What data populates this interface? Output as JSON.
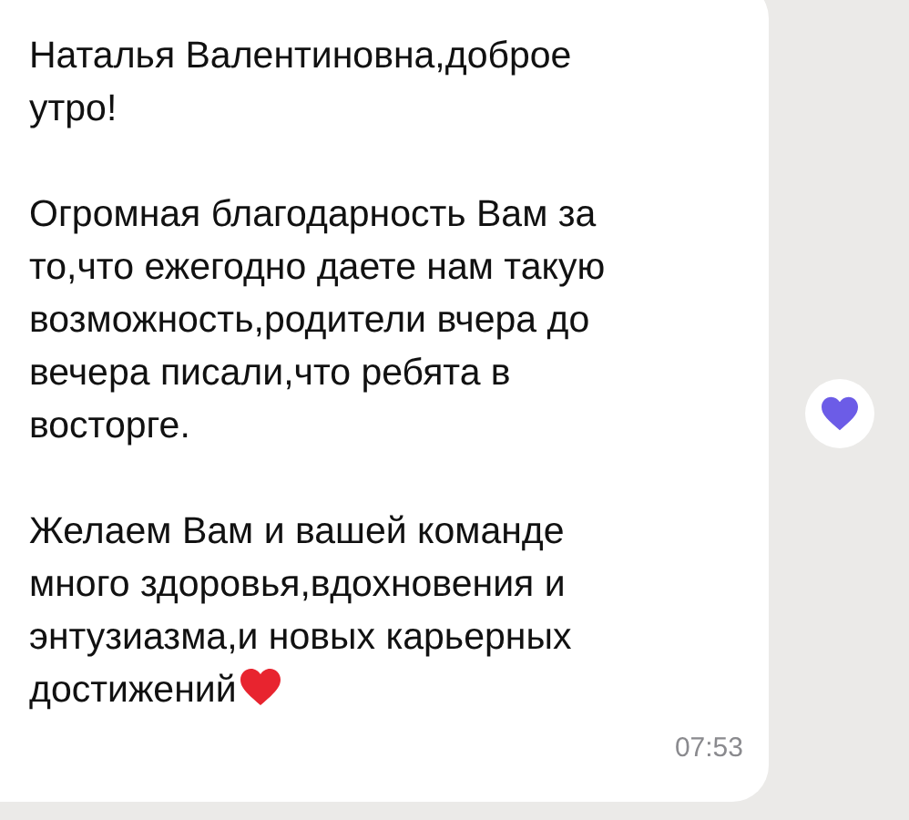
{
  "message": {
    "paragraphs": [
      {
        "lines": [
          "Наталья Валентиновна,доброе",
          "утро!"
        ],
        "heart": false
      },
      {
        "lines": [
          "Огромная благодарность Вам за",
          "то,что ежегодно даете нам такую",
          "возможность,родители вчера до",
          "вечера писали,что ребята в",
          "восторге."
        ],
        "heart": false
      },
      {
        "lines": [
          "Желаем Вам и вашей команде",
          "много здоровья,вдохновения и",
          "энтузиазма,и новых карьерных",
          "достижений"
        ],
        "heart": true
      }
    ],
    "time": "07:53",
    "reaction": {
      "color": "#6c5ce7"
    }
  }
}
